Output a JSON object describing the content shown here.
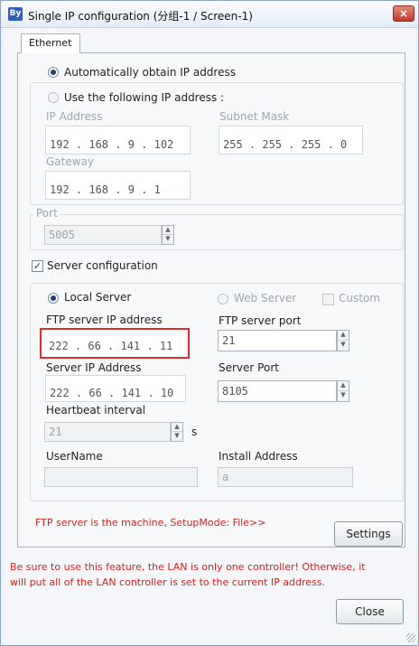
{
  "window": {
    "title": "Single IP configuration  (分组-1 / Screen-1)",
    "app_icon_text": "By",
    "close_glyph": "×"
  },
  "tabs": [
    {
      "label": "Ethernet",
      "selected": true
    }
  ],
  "ip": {
    "auto_label": "Automatically obtain IP address",
    "auto_selected": true,
    "manual_label": "Use the following IP address :",
    "manual_selected": false,
    "ip_address_label": "IP Address",
    "ip_address_value": "192 . 168 . 9  . 102",
    "subnet_mask_label": "Subnet Mask",
    "subnet_mask_value": "255 . 255 . 255 .  0",
    "gateway_label": "Gateway",
    "gateway_value": "192 . 168 . 9  .  1"
  },
  "port": {
    "label": "Port",
    "value": "5005"
  },
  "server_config": {
    "checkbox_label": "Server configuration",
    "checked": true,
    "local_server_label": "Local Server",
    "local_server_selected": true,
    "web_server_label": "Web Server",
    "web_server_selected": false,
    "custom_label": "Custom",
    "custom_checked": false,
    "ftp_ip_label": "FTP server IP address",
    "ftp_ip_value": "222 . 66  . 141 . 11",
    "ftp_port_label": "FTP server port",
    "ftp_port_value": "21",
    "server_ip_label": "Server IP Address",
    "server_ip_value": "222 . 66  . 141 . 10",
    "server_port_label": "Server Port",
    "server_port_value": "8105",
    "heartbeat_label": "Heartbeat interval",
    "heartbeat_value": "21",
    "heartbeat_unit": "s",
    "username_label": "UserName",
    "username_value": "",
    "install_address_label": "Install Address",
    "install_address_value": "a"
  },
  "ftp_note": "FTP server is the machine, SetupMode: File>>",
  "settings_button": "Settings",
  "warning_line1": "Be sure to use this feature, the LAN is only one controller! Otherwise, it",
  "warning_line2": "will put all of the LAN controller is set to the current IP address.",
  "close_button": "Close",
  "icons": {
    "spin_up": "▲",
    "spin_down": "▼",
    "check_mark": "✓"
  },
  "colors": {
    "warning_red": "#d0251f",
    "highlight_red": "#d8302a",
    "title_close_red": "#c0392b"
  }
}
